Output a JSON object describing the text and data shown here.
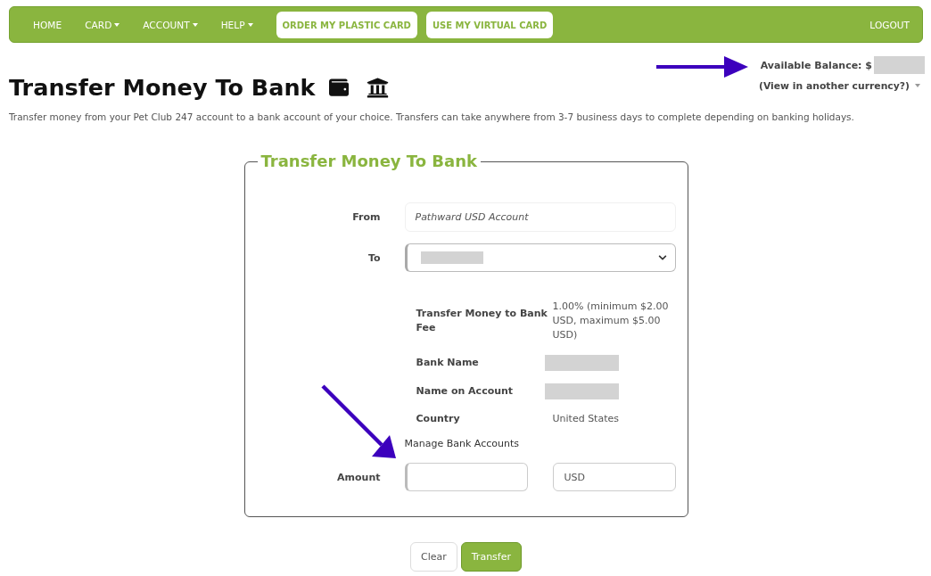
{
  "navbar": {
    "items": [
      {
        "label": "HOME",
        "kind": "link"
      },
      {
        "label": "CARD",
        "kind": "dropdown"
      },
      {
        "label": "ACCOUNT",
        "kind": "dropdown"
      },
      {
        "label": "HELP",
        "kind": "dropdown"
      },
      {
        "label": "ORDER MY PLASTIC CARD",
        "kind": "pill"
      },
      {
        "label": "USE MY VIRTUAL CARD",
        "kind": "pill"
      }
    ],
    "logout": "LOGOUT"
  },
  "balance": {
    "label": "Available Balance: $",
    "redacted": true,
    "currency_link": "(View in another currency?)"
  },
  "header": {
    "title": "Transfer Money To Bank",
    "description": "Transfer money from your Pet Club 247 account to a bank account of your choice. Transfers can take anywhere from 3-7 business days to complete depending on banking holidays."
  },
  "form": {
    "legend": "Transfer Money To Bank",
    "from": {
      "label": "From",
      "value": "Pathward USD Account"
    },
    "to": {
      "label": "To",
      "redacted": true
    },
    "details": [
      {
        "label": "Transfer Money to Bank Fee",
        "redacted": false,
        "value": "1.00% (minimum $2.00 USD, maximum $5.00 USD)"
      },
      {
        "label": "Bank Name",
        "redacted": true
      },
      {
        "label": "Name on Account",
        "redacted": true
      },
      {
        "label": "Country",
        "redacted": false,
        "value": "United States"
      }
    ],
    "manage_link": "Manage Bank Accounts",
    "amount": {
      "label": "Amount",
      "currency": "USD"
    }
  },
  "buttons": [
    {
      "label": "Clear",
      "kind": "secondary"
    },
    {
      "label": "Transfer",
      "kind": "primary"
    }
  ],
  "annotations": [
    {
      "kind": "arrow-right"
    },
    {
      "kind": "arrow-down-right"
    }
  ]
}
